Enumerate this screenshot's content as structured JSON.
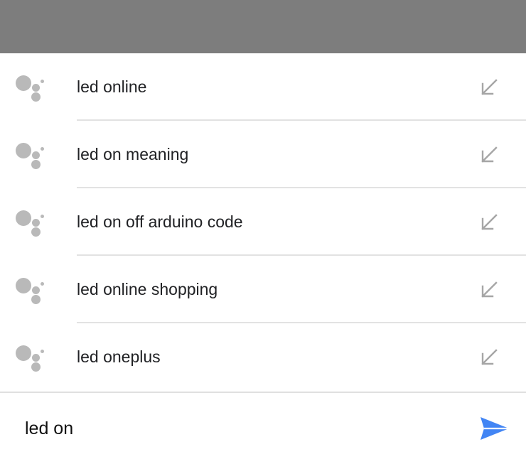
{
  "suggestions": [
    {
      "text": "led online"
    },
    {
      "text": "led on meaning"
    },
    {
      "text": "led on off arduino code"
    },
    {
      "text": "led online shopping"
    },
    {
      "text": "led oneplus"
    }
  ],
  "input": {
    "value": "led on"
  },
  "icons": {
    "suggestion_leading": "google-assistant-icon",
    "suggestion_trailing": "fill-query-arrow-icon",
    "send": "send-icon"
  },
  "colors": {
    "top_bar": "#7d7d7d",
    "icon_gray": "#b9b9b9",
    "send_blue": "#4285f4",
    "text": "#202124"
  }
}
